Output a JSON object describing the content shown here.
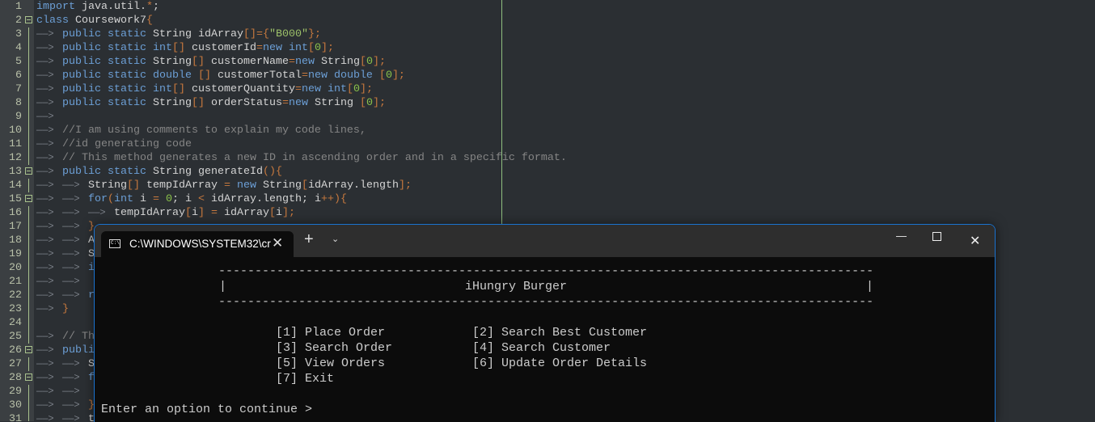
{
  "editor": {
    "lines": [
      {
        "n": "1",
        "tabs": 0,
        "tokens": [
          [
            "kw",
            "import"
          ],
          [
            "sp",
            " "
          ],
          [
            "id",
            "java.util."
          ],
          [
            "op",
            "*"
          ],
          [
            "id",
            ";"
          ]
        ]
      },
      {
        "n": "2",
        "tabs": 0,
        "fold": true,
        "tokens": [
          [
            "kw",
            "class"
          ],
          [
            "sp",
            " "
          ],
          [
            "id",
            "Coursework7"
          ],
          [
            "op",
            "{"
          ]
        ]
      },
      {
        "n": "3",
        "tabs": 1,
        "tokens": [
          [
            "kw",
            "public static"
          ],
          [
            "id",
            " String idArray"
          ],
          [
            "op",
            "[]={"
          ],
          [
            "str",
            "\"B000\""
          ],
          [
            "op",
            "};"
          ]
        ]
      },
      {
        "n": "4",
        "tabs": 1,
        "tokens": [
          [
            "kw",
            "public static int"
          ],
          [
            "op",
            "[]"
          ],
          [
            "id",
            " customerId"
          ],
          [
            "op",
            "="
          ],
          [
            "kw",
            "new int"
          ],
          [
            "op",
            "["
          ],
          [
            "num",
            "0"
          ],
          [
            "op",
            "];"
          ]
        ]
      },
      {
        "n": "5",
        "tabs": 1,
        "tokens": [
          [
            "kw",
            "public static"
          ],
          [
            "id",
            " String"
          ],
          [
            "op",
            "[]"
          ],
          [
            "id",
            " customerName"
          ],
          [
            "op",
            "="
          ],
          [
            "kw",
            "new"
          ],
          [
            "id",
            " String"
          ],
          [
            "op",
            "["
          ],
          [
            "num",
            "0"
          ],
          [
            "op",
            "];"
          ]
        ]
      },
      {
        "n": "6",
        "tabs": 1,
        "tokens": [
          [
            "kw",
            "public static double "
          ],
          [
            "op",
            "[]"
          ],
          [
            "id",
            " customerTotal"
          ],
          [
            "op",
            "="
          ],
          [
            "kw",
            "new double "
          ],
          [
            "op",
            "["
          ],
          [
            "num",
            "0"
          ],
          [
            "op",
            "];"
          ]
        ]
      },
      {
        "n": "7",
        "tabs": 1,
        "tokens": [
          [
            "kw",
            "public static int"
          ],
          [
            "op",
            "[]"
          ],
          [
            "id",
            " customerQuantity"
          ],
          [
            "op",
            "="
          ],
          [
            "kw",
            "new int"
          ],
          [
            "op",
            "["
          ],
          [
            "num",
            "0"
          ],
          [
            "op",
            "];"
          ]
        ]
      },
      {
        "n": "8",
        "tabs": 1,
        "tokens": [
          [
            "kw",
            "public static"
          ],
          [
            "id",
            " String"
          ],
          [
            "op",
            "[]"
          ],
          [
            "id",
            " orderStatus"
          ],
          [
            "op",
            "="
          ],
          [
            "kw",
            "new"
          ],
          [
            "id",
            " String "
          ],
          [
            "op",
            "["
          ],
          [
            "num",
            "0"
          ],
          [
            "op",
            "];"
          ]
        ]
      },
      {
        "n": "9",
        "tabs": 1,
        "tokens": []
      },
      {
        "n": "10",
        "tabs": 1,
        "tokens": [
          [
            "cm",
            "//I am using comments to explain my code lines,  "
          ]
        ]
      },
      {
        "n": "11",
        "tabs": 1,
        "tokens": [
          [
            "cm",
            "//id generating code "
          ]
        ]
      },
      {
        "n": "12",
        "tabs": 1,
        "tokens": [
          [
            "cm",
            "// This method generates a new ID in ascending order and in a specific format."
          ]
        ]
      },
      {
        "n": "13",
        "tabs": 1,
        "fold": true,
        "tokens": [
          [
            "kw",
            "public static"
          ],
          [
            "id",
            " String generateId"
          ],
          [
            "op",
            "(){"
          ]
        ]
      },
      {
        "n": "14",
        "tabs": 2,
        "tokens": [
          [
            "id",
            "String"
          ],
          [
            "op",
            "[]"
          ],
          [
            "id",
            " tempIdArray "
          ],
          [
            "op",
            "="
          ],
          [
            "kw",
            " new"
          ],
          [
            "id",
            " String"
          ],
          [
            "op",
            "["
          ],
          [
            "id",
            "idArray.length"
          ],
          [
            "op",
            "];"
          ]
        ]
      },
      {
        "n": "15",
        "tabs": 2,
        "fold": true,
        "tokens": [
          [
            "kw",
            "for"
          ],
          [
            "op",
            "("
          ],
          [
            "kw",
            "int"
          ],
          [
            "id",
            " i "
          ],
          [
            "op",
            "="
          ],
          [
            "num",
            " 0"
          ],
          [
            "id",
            ";"
          ],
          [
            "id",
            " i "
          ],
          [
            "op",
            "<"
          ],
          [
            "id",
            " idArray.length; i"
          ],
          [
            "op",
            "++){"
          ]
        ]
      },
      {
        "n": "16",
        "tabs": 3,
        "tokens": [
          [
            "id",
            "tempIdArray"
          ],
          [
            "op",
            "["
          ],
          [
            "id",
            "i"
          ],
          [
            "op",
            "]"
          ],
          [
            "op",
            " ="
          ],
          [
            "id",
            " idArray"
          ],
          [
            "op",
            "["
          ],
          [
            "id",
            "i"
          ],
          [
            "op",
            "];"
          ]
        ]
      },
      {
        "n": "17",
        "tabs": 2,
        "tokens": [
          [
            "op",
            "}"
          ]
        ]
      },
      {
        "n": "18",
        "tabs": 2,
        "tokens": [
          [
            "id",
            "A"
          ]
        ]
      },
      {
        "n": "19",
        "tabs": 2,
        "tokens": [
          [
            "id",
            "S"
          ]
        ]
      },
      {
        "n": "20",
        "tabs": 2,
        "tokens": [
          [
            "kw",
            "i"
          ]
        ]
      },
      {
        "n": "21",
        "tabs": 2,
        "tokens": []
      },
      {
        "n": "22",
        "tabs": 2,
        "tokens": [
          [
            "kw",
            "r"
          ]
        ]
      },
      {
        "n": "23",
        "tabs": 1,
        "tokens": [
          [
            "op",
            "}"
          ]
        ]
      },
      {
        "n": "24",
        "tabs": 0,
        "tokens": []
      },
      {
        "n": "25",
        "tabs": 1,
        "tokens": [
          [
            "cm",
            "// Th"
          ]
        ]
      },
      {
        "n": "26",
        "tabs": 1,
        "fold": true,
        "tokens": [
          [
            "kw",
            "publi"
          ]
        ]
      },
      {
        "n": "27",
        "tabs": 2,
        "tokens": [
          [
            "id",
            "S"
          ]
        ]
      },
      {
        "n": "28",
        "tabs": 2,
        "fold": true,
        "tokens": [
          [
            "kw",
            "f"
          ]
        ]
      },
      {
        "n": "29",
        "tabs": 2,
        "tokens": []
      },
      {
        "n": "30",
        "tabs": 2,
        "tokens": [
          [
            "op",
            "}"
          ]
        ]
      },
      {
        "n": "31",
        "tabs": 2,
        "tokens": [
          [
            "id",
            "t"
          ]
        ]
      }
    ]
  },
  "terminal": {
    "tab_title": "C:\\WINDOWS\\SYSTEM32\\cr",
    "tab_icon_text": "C:\\_",
    "close_tab": "✕",
    "new_tab": "+",
    "dropdown": "⌄",
    "minimize": "—",
    "maximize": "☐",
    "close": "✕",
    "accent_color": "#1a73d0",
    "rule": "------------------------------------------------------------------------------------------",
    "border_char": "|",
    "app_title": "iHungry Burger",
    "menu": {
      "left": [
        "[1] Place Order",
        "[3] Search Order",
        "[5] View Orders",
        "[7] Exit"
      ],
      "right": [
        "[2] Search Best Customer",
        "[4] Search Customer",
        "[6] Update Order Details"
      ]
    },
    "prompt": "Enter an option to continue >"
  }
}
